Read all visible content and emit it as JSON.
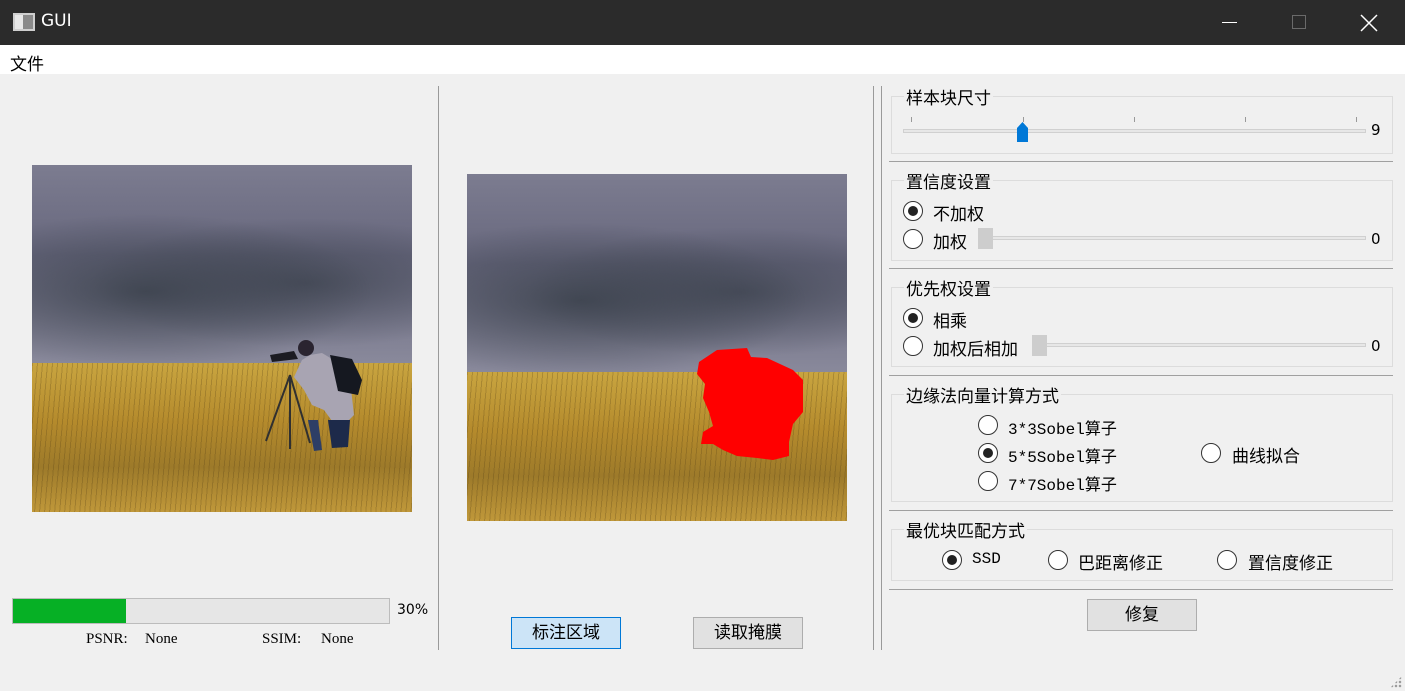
{
  "window": {
    "title": "GUI"
  },
  "menu": {
    "items": [
      "文件"
    ]
  },
  "progress": {
    "value": 30,
    "label": "30%"
  },
  "metrics": {
    "psnr_label": "PSNR:",
    "psnr_value": "None",
    "ssim_label": "SSIM:",
    "ssim_value": "None"
  },
  "buttons": {
    "mark_region": "标注区域",
    "read_mask": "读取掩膜",
    "repair": "修复"
  },
  "patch_size": {
    "title": "样本块尺寸",
    "value": "9"
  },
  "confidence": {
    "title": "置信度设置",
    "options": [
      "不加权",
      "加权"
    ],
    "selected": 0,
    "weight_value": "0"
  },
  "priority": {
    "title": "优先权设置",
    "options": [
      "相乘",
      "加权后相加"
    ],
    "selected": 0,
    "weight_value": "0"
  },
  "edge_normal": {
    "title": "边缘法向量计算方式",
    "options": [
      "3*3Sobel算子",
      "5*5Sobel算子",
      "7*7Sobel算子",
      "曲线拟合"
    ],
    "selected": 1
  },
  "best_match": {
    "title": "最优块匹配方式",
    "options": [
      "SSD",
      "巴距离修正",
      "置信度修正"
    ],
    "selected": 0
  },
  "colors": {
    "progress_fill": "#06b025",
    "mask": "#ff0000",
    "accent": "#0078d7"
  }
}
